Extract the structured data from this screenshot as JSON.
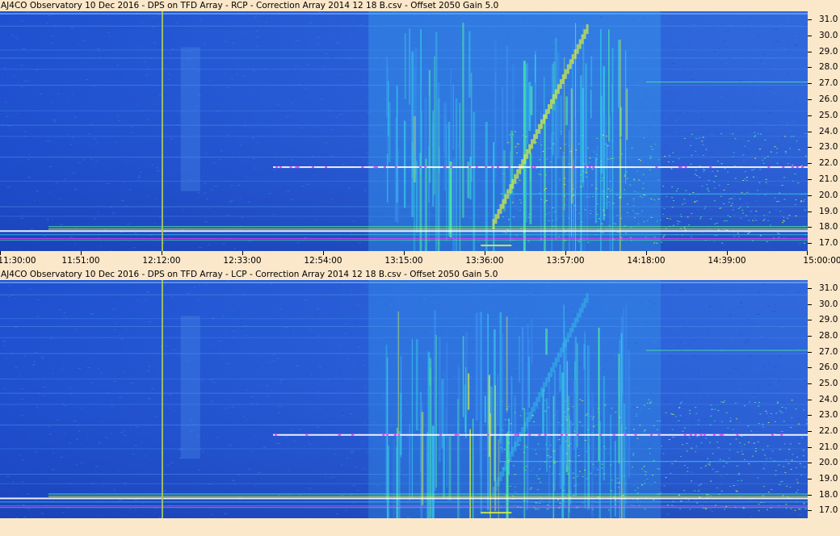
{
  "charts": {
    "top": {
      "title": "AJ4CO Observatory 10 Dec 2016  -  DPS on TFD Array  -  RCP  -  Correction Array 2014 12 18 B.csv  -  Offset 2050  Gain 5.0"
    },
    "bottom": {
      "title": "AJ4CO Observatory 10 Dec 2016  -  DPS on TFD Array  -  LCP  -  Correction Array 2014 12 18 B.csv  -  Offset 2050  Gain 5.0"
    }
  },
  "chart_data": [
    {
      "type": "heatmap",
      "title": "AJ4CO Observatory 10 Dec 2016  -  DPS on TFD Array  -  RCP  -  Correction Array 2014 12 18 B.csv  -  Offset 2050  Gain 5.0",
      "polarization": "RCP",
      "x_tick_labels": [
        "11:30:00",
        "11:51:00",
        "12:12:00",
        "12:33:00",
        "12:54:00",
        "13:15:00",
        "13:36:00",
        "13:57:00",
        "14:18:00",
        "14:39:00",
        "15:00:00"
      ],
      "y_tick_labels": [
        "31.0",
        "30.0",
        "29.0",
        "28.0",
        "27.0",
        "26.0",
        "25.0",
        "24.0",
        "23.0",
        "22.0",
        "21.0",
        "20.0",
        "19.0",
        "18.0",
        "17.0"
      ],
      "xlim": [
        "11:30:00",
        "15:00:00"
      ],
      "ylim": [
        16.5,
        31.5
      ],
      "y_axis_side": "right",
      "colormap": [
        "#1a48c8",
        "#2d63d8",
        "#3a8ff0",
        "#35c7e8",
        "#4ef0a0",
        "#d8f040",
        "#ffffff",
        "#ff40ff"
      ],
      "features": {
        "storm_time": [
          "13:10:00",
          "14:05:00"
        ],
        "rfi_frequencies": [
          17.3,
          17.8,
          18.0,
          21.8,
          20.1,
          27.1
        ]
      }
    },
    {
      "type": "heatmap",
      "title": "AJ4CO Observatory 10 Dec 2016  -  DPS on TFD Array  -  LCP  -  Correction Array 2014 12 18 B.csv  -  Offset 2050  Gain 5.0",
      "polarization": "LCP",
      "y_tick_labels": [
        "31.0",
        "30.0",
        "29.0",
        "28.0",
        "27.0",
        "26.0",
        "25.0",
        "24.0",
        "23.0",
        "22.0",
        "21.0",
        "20.0",
        "19.0",
        "18.0",
        "17.0"
      ],
      "ylim": [
        16.5,
        31.5
      ],
      "y_axis_side": "right",
      "colormap": [
        "#1a48c8",
        "#2d63d8",
        "#3a8ff0",
        "#35c7e8",
        "#4ef0a0",
        "#d8f040",
        "#ffffff",
        "#ff40ff"
      ],
      "features": {
        "storm_time": [
          "13:10:00",
          "14:05:00"
        ],
        "rfi_frequencies": [
          17.3,
          17.8,
          18.0,
          21.8,
          20.1,
          27.1
        ]
      }
    }
  ]
}
